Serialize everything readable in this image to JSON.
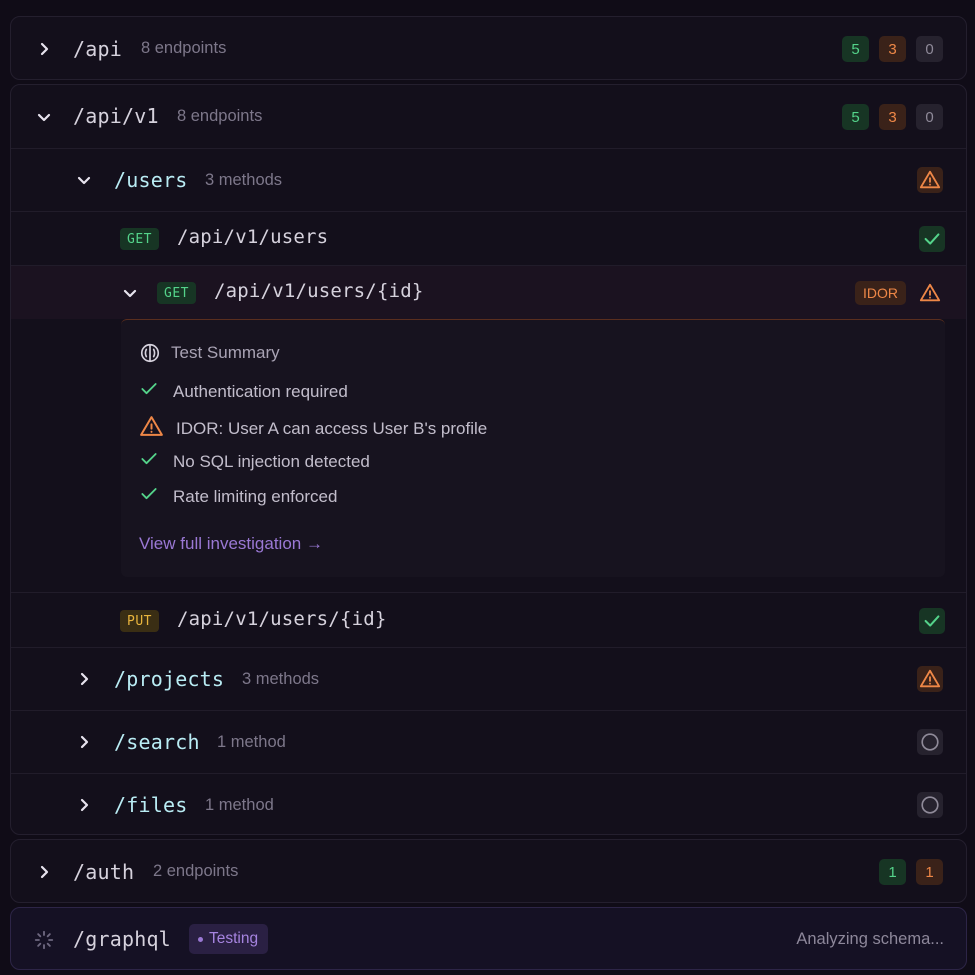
{
  "groups": {
    "api": {
      "path": "/api",
      "count": "8 endpoints",
      "badges": [
        "5",
        "3",
        "0"
      ]
    },
    "api_v1": {
      "path": "/api/v1",
      "count": "8 endpoints",
      "badges": [
        "5",
        "3",
        "0"
      ],
      "resources": {
        "users": {
          "path": "/users",
          "count": "3 methods",
          "endpoints": [
            {
              "method": "GET",
              "path": "/api/v1/users",
              "status": "check"
            },
            {
              "method": "GET",
              "path": "/api/v1/users/{id}",
              "tag": "IDOR",
              "status": "warn"
            },
            {
              "method": "PUT",
              "path": "/api/v1/users/{id}",
              "status": "check"
            }
          ]
        },
        "projects": {
          "path": "/projects",
          "count": "3 methods",
          "status": "warn"
        },
        "search": {
          "path": "/search",
          "count": "1 method",
          "status": "idle"
        },
        "files": {
          "path": "/files",
          "count": "1 method",
          "status": "idle"
        }
      }
    },
    "auth": {
      "path": "/auth",
      "count": "2 endpoints",
      "badges": [
        "1",
        "1"
      ]
    },
    "graphql": {
      "path": "/graphql",
      "status_pill": "Testing",
      "status_text": "Analyzing schema..."
    }
  },
  "summary": {
    "title": "Test Summary",
    "items": [
      {
        "icon": "check-icon",
        "text": "Authentication required"
      },
      {
        "icon": "warning-icon",
        "text": "IDOR: User A can access User B's profile"
      },
      {
        "icon": "check-icon",
        "text": "No SQL injection detected"
      },
      {
        "icon": "check-icon",
        "text": "Rate limiting enforced"
      }
    ],
    "link": "View full investigation →"
  },
  "colors": {
    "background": "#100c17",
    "green": "#54d38a",
    "orange": "#ee8747",
    "purple": "#9a78d4",
    "cyan": "#b9ecf4"
  }
}
